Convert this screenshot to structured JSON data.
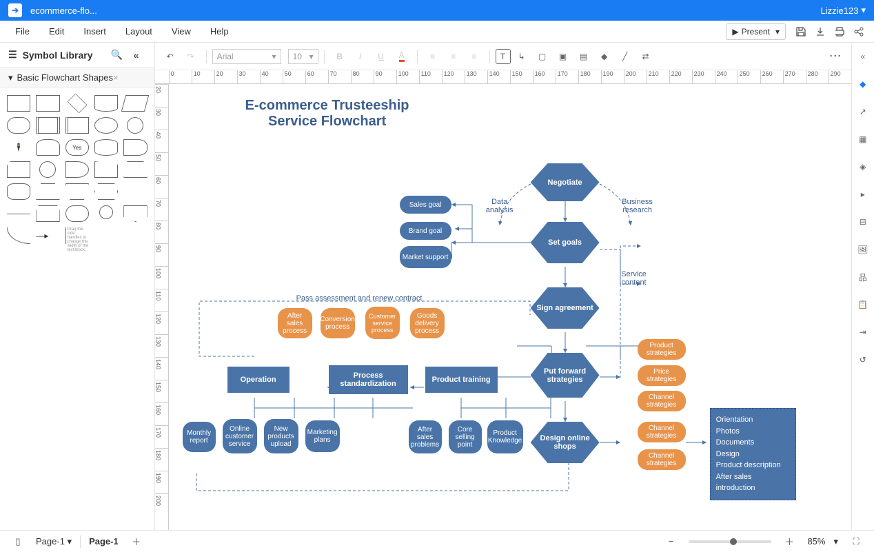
{
  "title": "ecommerce-flo...",
  "user": "Lizzie123",
  "menu": {
    "file": "File",
    "edit": "Edit",
    "insert": "Insert",
    "layout": "Layout",
    "view": "View",
    "help": "Help",
    "present": "Present"
  },
  "sidebar": {
    "title": "Symbol Library",
    "category": "Basic Flowchart Shapes"
  },
  "toolbar": {
    "font": "Arial",
    "size": "10"
  },
  "status": {
    "page_dropdown": "Page-1",
    "page_tab": "Page-1",
    "zoom": "85%"
  },
  "flowchart": {
    "title": "E-commerce Trusteeship Service Flowchart",
    "negotiate": "Negotiate",
    "setgoals": "Set goals",
    "sign": "Sign agreement",
    "putforward": "Put forward strategies",
    "design": "Design online shops",
    "salesgoal": "Sales goal",
    "brandgoal": "Brand goal",
    "market": "Market support",
    "data": "Data analysis",
    "business": "Business research",
    "service": "Service content",
    "pass": "Pass assessment and renew contract",
    "aftersales": "After sales process",
    "conversion": "Conversion process",
    "customer": "Customer service process",
    "goods": "Goods delivery process",
    "operation": "Operation",
    "process": "Process standardization",
    "training": "Product training",
    "monthly": "Monthly report",
    "online": "Online customer service",
    "newprod": "New products upload",
    "marketing": "Marketing plans",
    "aftersales2": "After sales problems",
    "core": "Core selling point",
    "prodknow": "Product Knowledge",
    "prodstrat": "Product strategies",
    "pricestrat": "Price strategies",
    "chanstrat": "Channel strategies",
    "chanstrat2": "Channel strategies",
    "chanstrat3": "Channel strategies",
    "list": "Orientation\nPhotos\nDocuments\nDesign\nProduct description\nAfter sales introduction"
  }
}
